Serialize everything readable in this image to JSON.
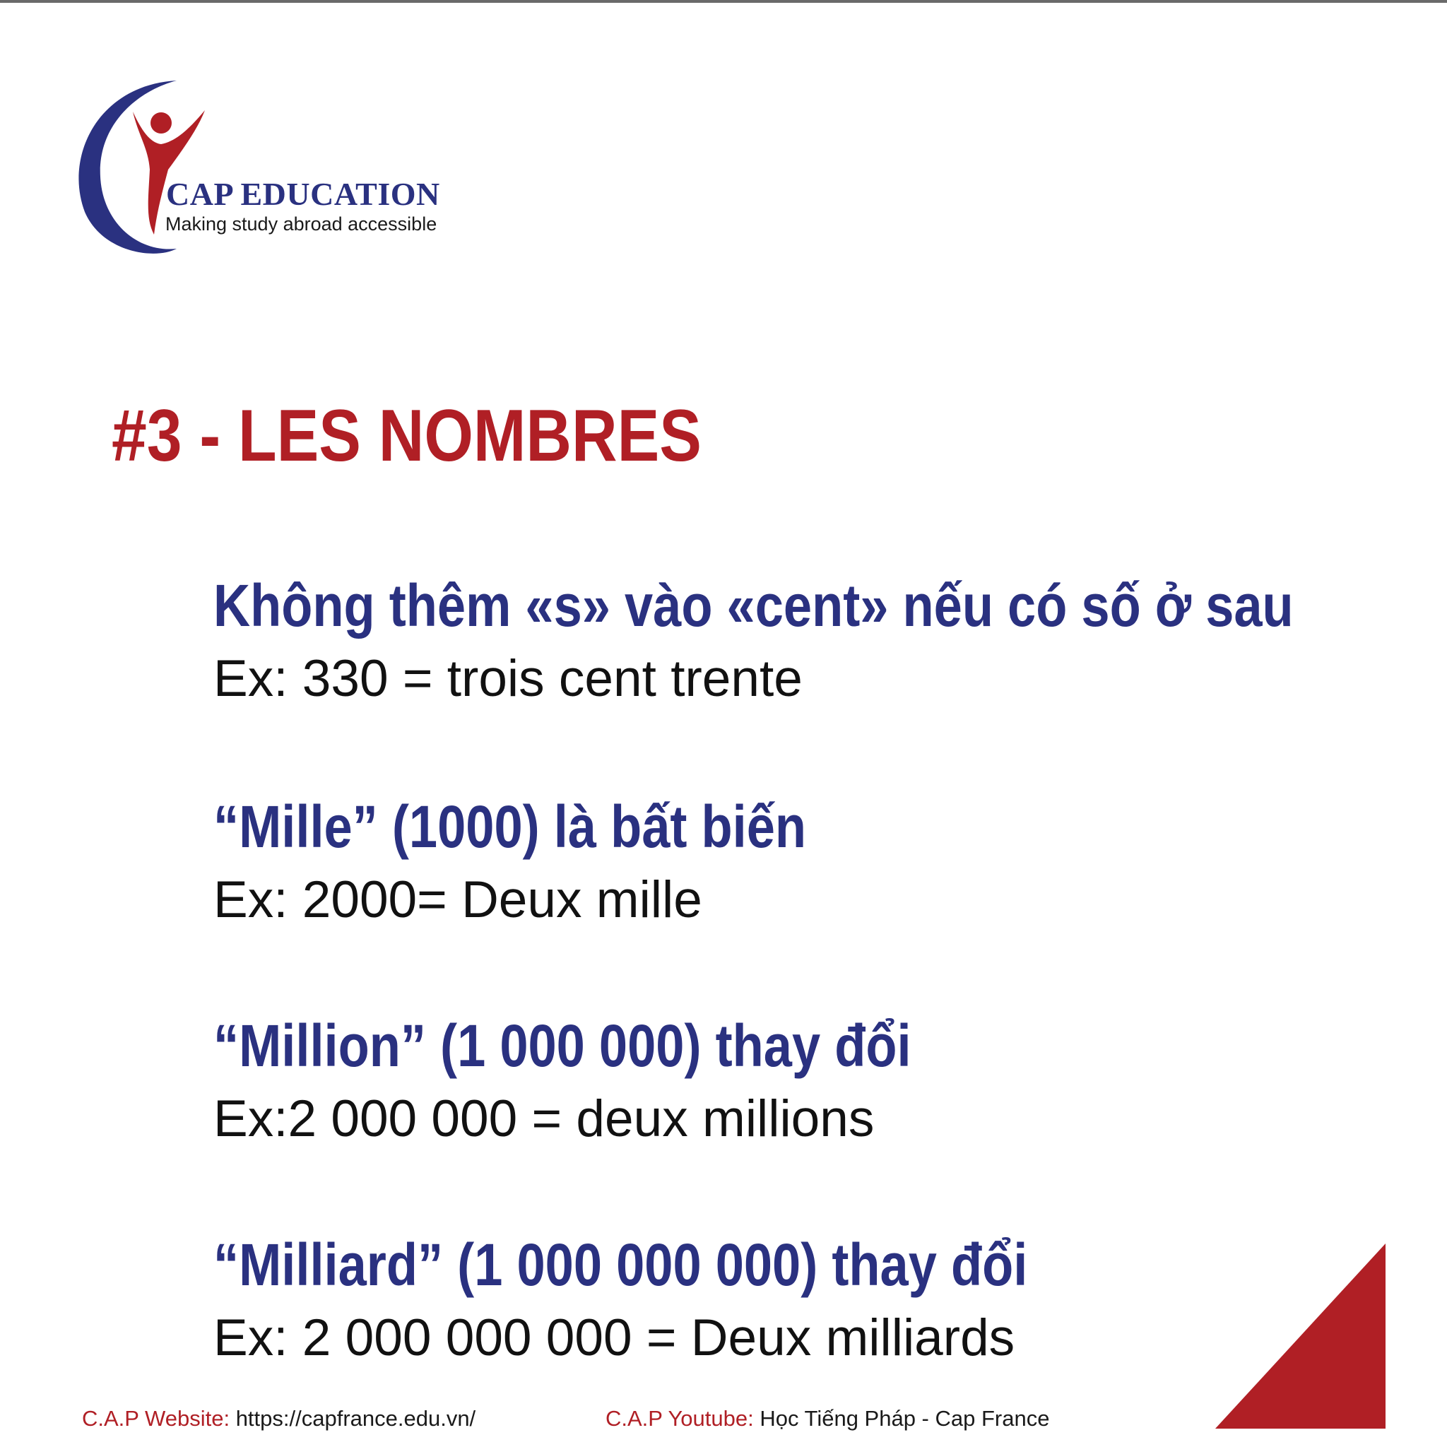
{
  "brand": {
    "name": "CAP EDUCATION",
    "tagline": "Making study abroad accessible",
    "colors": {
      "navy": "#2a3180",
      "red": "#b01f25"
    }
  },
  "title": "#3 - LES NOMBRES",
  "rules": [
    {
      "heading": "Không thêm «s» vào «cent» nếu có số ở sau",
      "example": "Ex: 330 = trois cent trente"
    },
    {
      "heading": "“Mille” (1000) là bất biến",
      "example": "Ex: 2000= Deux mille"
    },
    {
      "heading": "“Million” (1 000 000) thay đổi",
      "example": "Ex:2 000 000 = deux millions"
    },
    {
      "heading": "“Milliard” (1 000 000 000) thay đổi",
      "example": "Ex: 2 000 000 000 = Deux milliards"
    }
  ],
  "footer": {
    "website_label": "C.A.P Website:",
    "website_value": "https://capfrance.edu.vn/",
    "youtube_label": "C.A.P Youtube:",
    "youtube_value": "Học Tiếng Pháp - Cap France"
  }
}
